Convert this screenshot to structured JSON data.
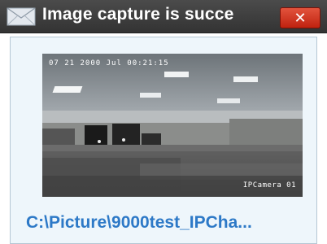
{
  "window": {
    "title": "Image capture is succe",
    "title_icon": "envelope-icon",
    "close_label": "✕",
    "close_icon": "close-icon"
  },
  "capture": {
    "timestamp": "07 21 2000 Jul 00:21:15",
    "camera_name": "IPCamera 01",
    "file_path": "C:\\Picture\\9000test_IPCha..."
  },
  "colors": {
    "titlebar": "#3c3c3c",
    "close_button": "#d43d24",
    "client_background": "#eef6fb",
    "link": "#2d79c7"
  }
}
